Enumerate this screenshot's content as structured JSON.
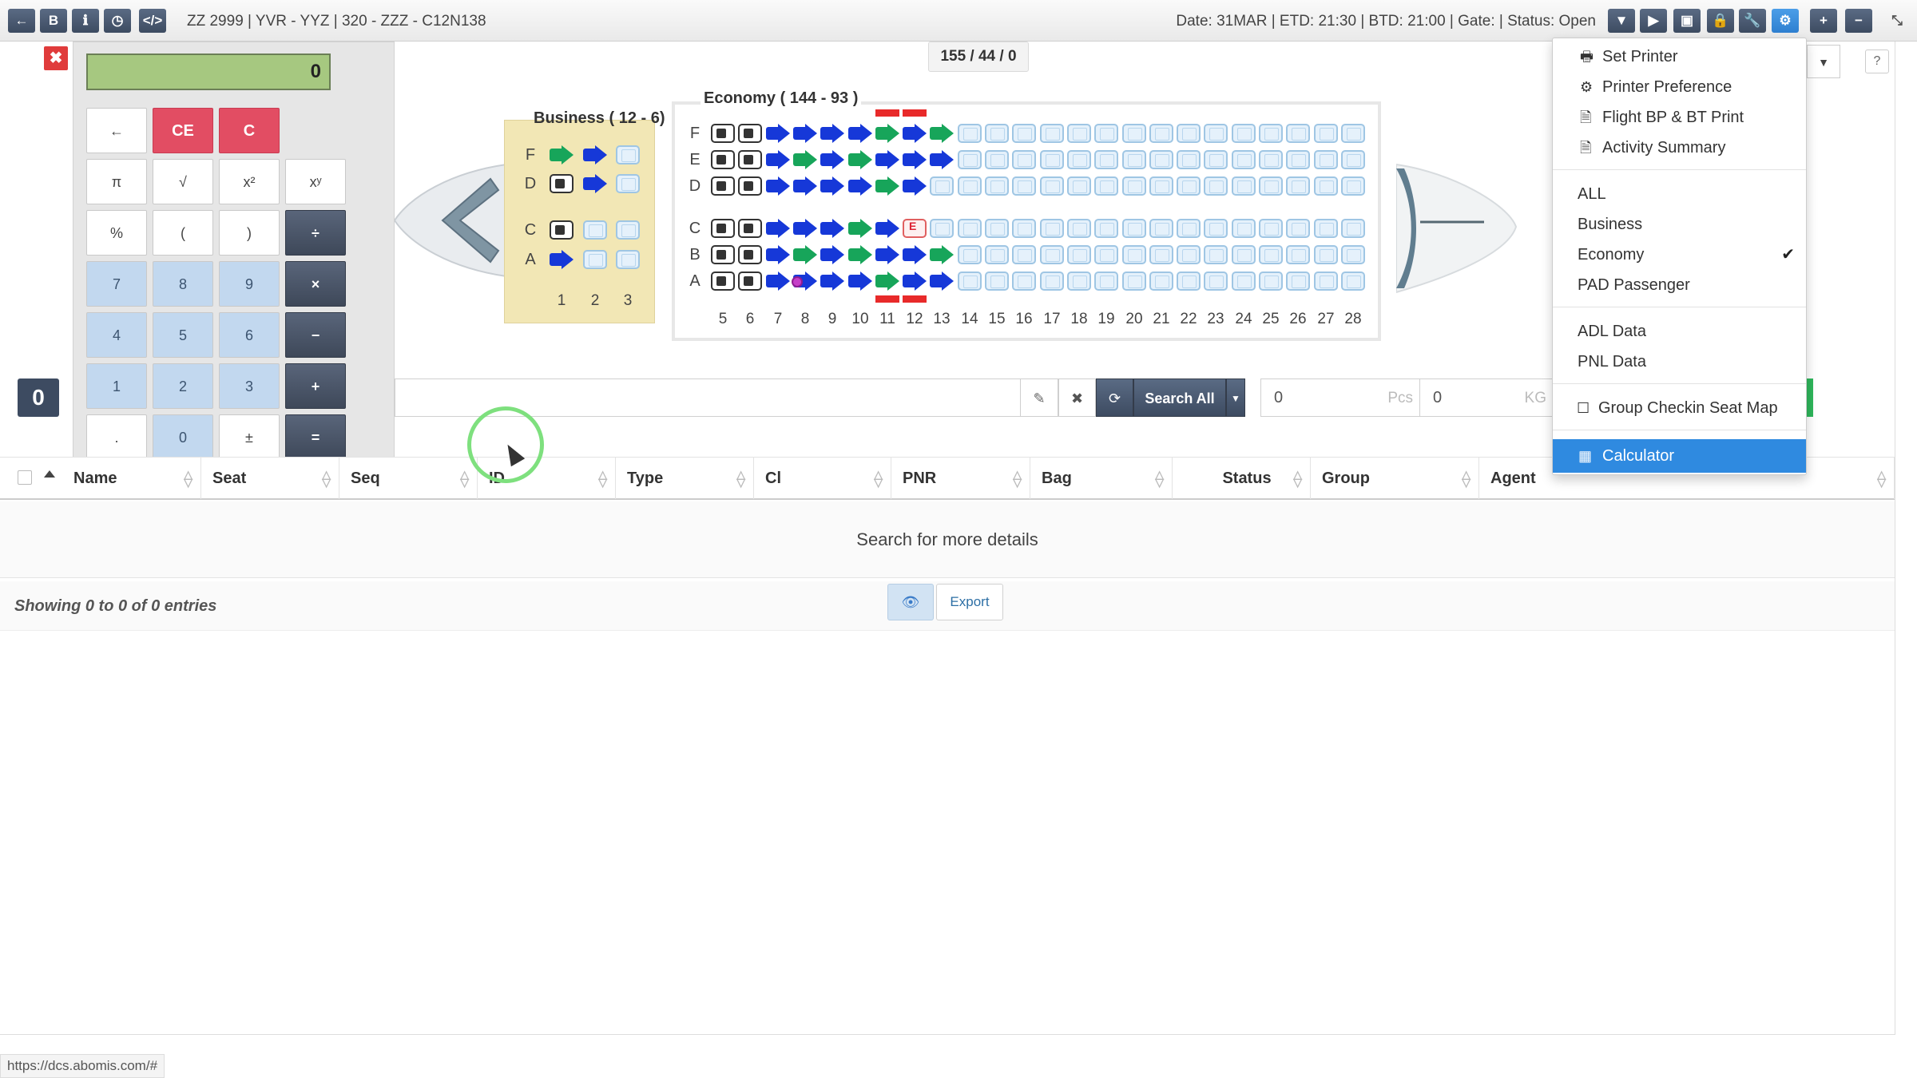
{
  "topbar": {
    "flight_title": "ZZ 2999 | YVR - YYZ | 320 - ZZZ - C12N138",
    "flight_status": "Date: 31MAR | ETD: 21:30 | BTD: 21:00 | Gate: | Status: Open",
    "left_buttons": [
      {
        "name": "back-icon",
        "glyph": "←"
      },
      {
        "name": "bold-b-icon",
        "glyph": "B"
      },
      {
        "name": "info-icon",
        "glyph": "ℹ"
      },
      {
        "name": "clock-icon",
        "glyph": "◷"
      },
      {
        "name": "code-icon",
        "glyph": "</>"
      }
    ],
    "right_buttons": [
      {
        "name": "filter-icon",
        "glyph": "▼"
      },
      {
        "name": "play-icon",
        "glyph": "▶"
      },
      {
        "name": "briefcase-icon",
        "glyph": "▣"
      },
      {
        "name": "lock-icon",
        "glyph": "🔒"
      },
      {
        "name": "wrench-icon",
        "glyph": "🔧"
      },
      {
        "name": "cogs-icon",
        "glyph": "⚙"
      },
      {
        "name": "add-user-icon",
        "glyph": "+"
      },
      {
        "name": "minus-icon",
        "glyph": "−"
      },
      {
        "name": "compress-icon",
        "glyph": "⤡"
      }
    ]
  },
  "calculator": {
    "display": "0",
    "close_glyph": "✖",
    "keys": [
      [
        "←",
        "CE",
        "C"
      ],
      [
        "π",
        "√",
        "x²",
        "xʸ"
      ],
      [
        "%",
        "(",
        ")",
        "÷"
      ],
      [
        "7",
        "8",
        "9",
        "×"
      ],
      [
        "4",
        "5",
        "6",
        "−"
      ],
      [
        "1",
        "2",
        "3",
        "+"
      ],
      [
        ".",
        "0",
        "±",
        "="
      ]
    ]
  },
  "seatmap": {
    "counter": "155 / 44 / 0",
    "business": {
      "title": "Business ( 12 - 6)",
      "rows": [
        "F",
        "D",
        "C",
        "A"
      ],
      "columns": [
        "1",
        "2",
        "3"
      ],
      "seats": {
        "F": [
          "green",
          "blue",
          "empty"
        ],
        "D": [
          "blocked",
          "blue",
          "empty"
        ],
        "C": [
          "blocked",
          "empty",
          "empty"
        ],
        "A": [
          "blue",
          "empty",
          "empty"
        ]
      }
    },
    "economy": {
      "title": "Economy ( 144 - 93 )",
      "rows": [
        "F",
        "E",
        "D",
        "C",
        "B",
        "A"
      ],
      "columns": [
        "5",
        "6",
        "7",
        "8",
        "9",
        "10",
        "11",
        "12",
        "13",
        "14",
        "15",
        "16",
        "17",
        "18",
        "19",
        "20",
        "21",
        "22",
        "23",
        "24",
        "25",
        "26",
        "27",
        "28"
      ],
      "seats": {
        "F": [
          "blocked",
          "blocked",
          "blue",
          "blue",
          "blue",
          "blue",
          "green",
          "blue",
          "green"
        ],
        "E": [
          "blocked",
          "blocked",
          "blue",
          "green",
          "blue",
          "green",
          "blue",
          "blue",
          "blue"
        ],
        "D": [
          "blocked",
          "blocked",
          "blue",
          "blue",
          "blue",
          "blue",
          "green",
          "blue"
        ],
        "C": [
          "blocked",
          "blocked",
          "blue",
          "blue",
          "blue",
          "green",
          "blue",
          "special"
        ],
        "B": [
          "blocked",
          "blocked",
          "blue",
          "green",
          "blue",
          "green",
          "blue",
          "blue",
          "green"
        ],
        "A": [
          "blocked",
          "blocked",
          "blue",
          "pink",
          "blue",
          "blue",
          "green",
          "blue",
          "blue"
        ]
      },
      "exit_columns": [
        "11",
        "12"
      ]
    }
  },
  "search": {
    "count_badge": "0",
    "wand_glyph": "✎",
    "clear_glyph": "✖",
    "refresh_glyph": "⟳",
    "search_all_label": "Search All",
    "pcs_value": "0",
    "pcs_unit": "Pcs",
    "kg_value": "0",
    "kg_unit": "KG"
  },
  "table": {
    "columns": [
      "Name",
      "Seat",
      "Seq",
      "ID",
      "Type",
      "Cl",
      "PNR",
      "Bag",
      "Status",
      "Group",
      "Agent"
    ],
    "empty_message": "Search for more details",
    "showing": "Showing 0 to 0 of 0 entries",
    "export_label": "Export",
    "eye_glyph": "👁"
  },
  "menu": {
    "group1": [
      {
        "icon": "🖶",
        "label": "Set Printer",
        "icon_name": "printer-icon"
      },
      {
        "icon": "⚙",
        "label": "Printer Preference",
        "icon_name": "gear-icon"
      },
      {
        "icon": "🗎",
        "label": "Flight BP & BT Print",
        "icon_name": "document-icon"
      },
      {
        "icon": "🗎",
        "label": "Activity Summary",
        "icon_name": "document-icon"
      }
    ],
    "group2": [
      "ALL",
      "Business",
      "Economy",
      "PAD Passenger"
    ],
    "selected_class": "Economy",
    "check_glyph": "✔",
    "group3": [
      "ADL Data",
      "PNL Data"
    ],
    "group4": {
      "icon": "☐",
      "label": "Group Checkin Seat Map"
    },
    "group5": {
      "icon": "▦",
      "label": "Calculator"
    }
  },
  "misc": {
    "help_glyph": "?",
    "dropdown_glyph": "▼",
    "status_url": "https://dcs.abomis.com/#"
  }
}
